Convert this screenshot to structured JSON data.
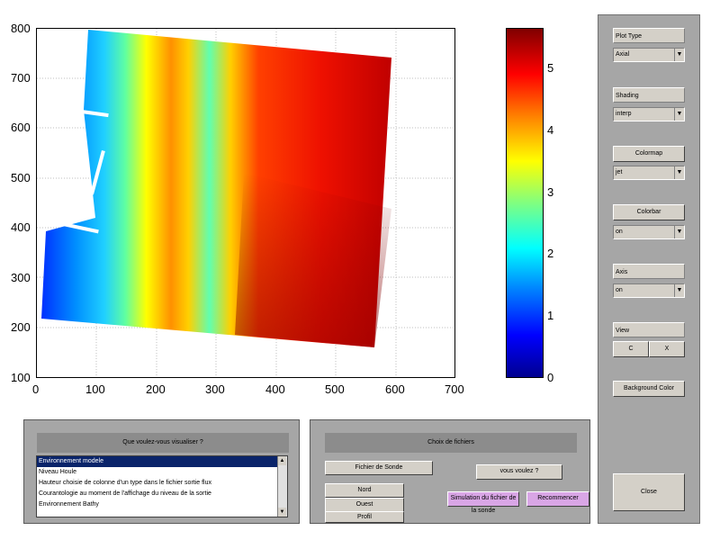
{
  "plot": {
    "x_ticks": [
      "0",
      "100",
      "200",
      "300",
      "400",
      "500",
      "600",
      "700"
    ],
    "y_ticks": [
      "800",
      "700",
      "600",
      "500",
      "400",
      "300",
      "200",
      "100"
    ],
    "colorbar_ticks": [
      "5",
      "4",
      "3",
      "2",
      "1",
      "0"
    ]
  },
  "right_panel": {
    "plot_type_label": "Plot Type",
    "plot_type_value": "Axial",
    "shading_label": "Shading",
    "shading_value": "interp",
    "colormap_label": "Colormap",
    "colormap_value": "jet",
    "colorbar_label": "Colorbar",
    "colorbar_value": "on",
    "axis_label": "Axis",
    "axis_value": "on",
    "view_label": "View",
    "view_btn_1": "C",
    "view_btn_2": "X",
    "background_color_button": "Background Color",
    "close_button": "Close"
  },
  "bottom_left": {
    "title": "Que voulez-vous visualiser ?",
    "items": [
      "Environnement modele",
      "Niveau Houle",
      "Hauteur choisie de colonne d'un type dans le fichier sortie flux",
      "Courantologie au moment de l'affichage du niveau de la sortie",
      "Environnement Bathy"
    ],
    "selected_index": 0
  },
  "bottom_mid": {
    "title": "Choix de fichiers",
    "file_button": "Fichier de Sonde",
    "opt1": "Nord",
    "opt2": "Ouest",
    "opt3": "Profil",
    "question": "vous voulez ?",
    "simulate_button": "Simulation du fichier de la sonde",
    "restart_button": "Recommencer"
  }
}
